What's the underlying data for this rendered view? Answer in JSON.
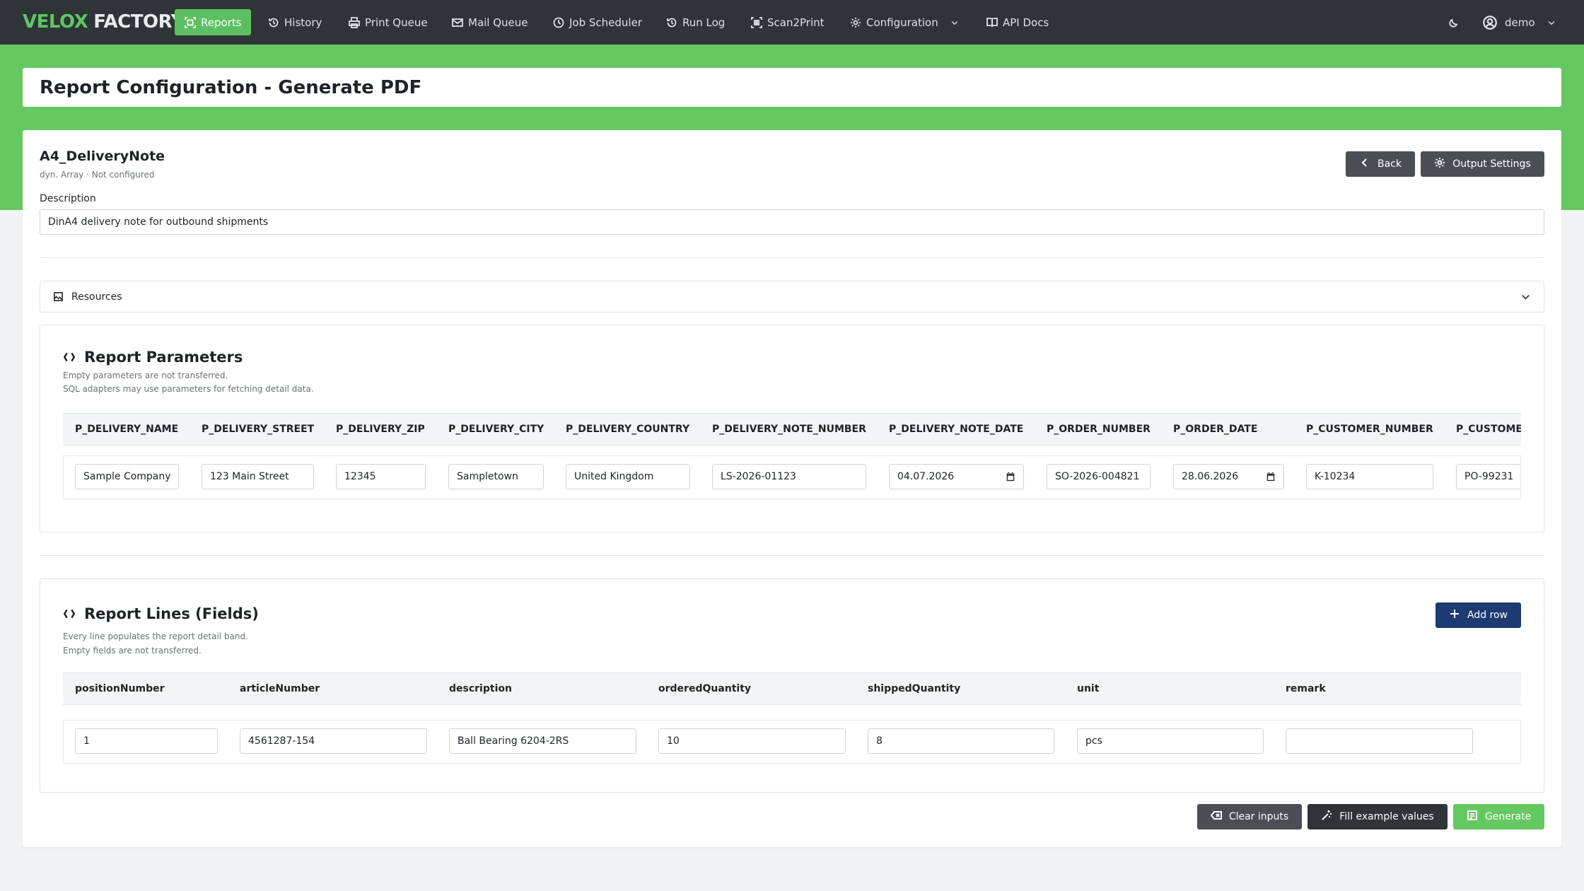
{
  "brand": {
    "part1": "VELOX",
    "part2": "FACTORY"
  },
  "nav": {
    "reports": "Reports",
    "history": "History",
    "print_queue": "Print Queue",
    "mail_queue": "Mail Queue",
    "job_scheduler": "Job Scheduler",
    "run_log": "Run Log",
    "scan2print": "Scan2Print",
    "configuration": "Configuration",
    "api_docs": "API Docs",
    "user": "demo"
  },
  "page_title": "Report Configuration - Generate PDF",
  "report": {
    "name": "A4_DeliveryNote",
    "meta": "dyn. Array · Not configured",
    "back_label": "Back",
    "output_settings_label": "Output Settings",
    "description_label": "Description",
    "description_value": "DinA4 delivery note for outbound shipments"
  },
  "resources": {
    "label": "Resources"
  },
  "parameters": {
    "title": "Report Parameters",
    "note1": "Empty parameters are not transferred.",
    "note2": "SQL adapters may use parameters for fetching detail data.",
    "headers": [
      "P_DELIVERY_NAME",
      "P_DELIVERY_STREET",
      "P_DELIVERY_ZIP",
      "P_DELIVERY_CITY",
      "P_DELIVERY_COUNTRY",
      "P_DELIVERY_NOTE_NUMBER",
      "P_DELIVERY_NOTE_DATE",
      "P_ORDER_NUMBER",
      "P_ORDER_DATE",
      "P_CUSTOMER_NUMBER",
      "P_CUSTOME"
    ],
    "values": [
      "Sample Company",
      "123 Main Street",
      "12345",
      "Sampletown",
      "United Kingdom",
      "LS-2026-01123",
      "04.07.2026",
      "SO-2026-004821",
      "28.06.2026",
      "K-10234",
      "PO-99231"
    ]
  },
  "lines": {
    "title": "Report Lines (Fields)",
    "note1": "Every line populates the report detail band.",
    "note2": "Empty fields are not transferred.",
    "add_row_label": "Add row",
    "headers": [
      "positionNumber",
      "articleNumber",
      "description",
      "orderedQuantity",
      "shippedQuantity",
      "unit",
      "remark"
    ],
    "rows": [
      [
        "1",
        "4561287-154",
        "Ball Bearing 6204-2RS",
        "10",
        "8",
        "pcs",
        ""
      ]
    ]
  },
  "actions": {
    "clear_label": "Clear inputs",
    "fill_label": "Fill example values",
    "generate_label": "Generate"
  },
  "colors": {
    "accent": "#66c860",
    "navbar": "#2f3437",
    "navy": "#1d3a72"
  }
}
